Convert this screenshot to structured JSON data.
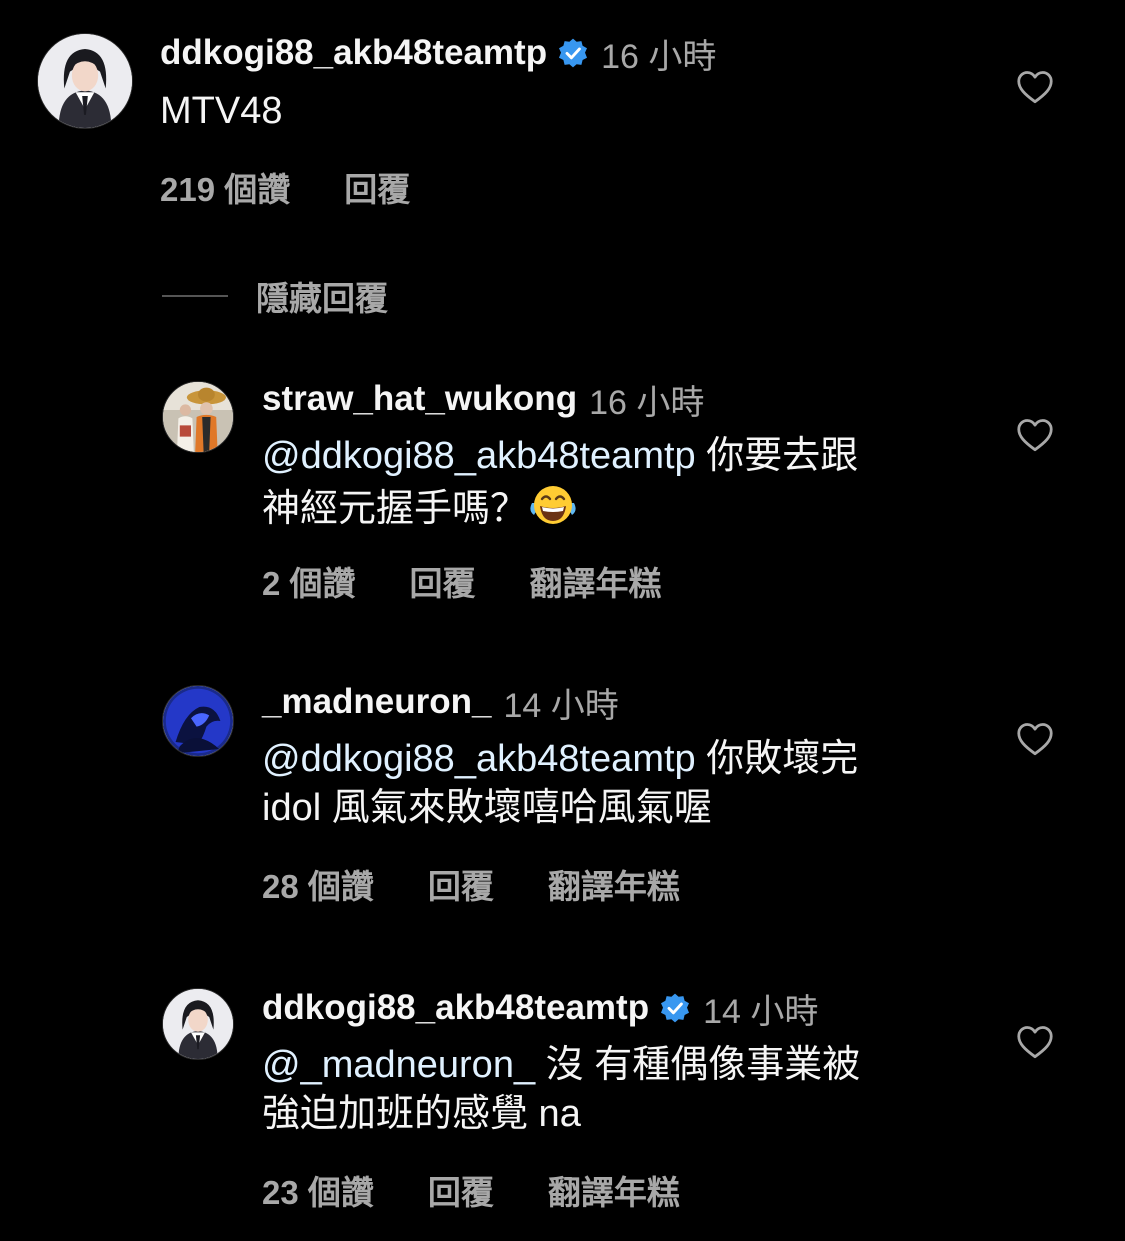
{
  "comments": [
    {
      "username": "ddkogi88_akb48teamtp",
      "verified": true,
      "time": "16 小時",
      "text": "MTV48",
      "likes": "219 個讚",
      "reply": "回覆",
      "translate": ""
    },
    {
      "username": "straw_hat_wukong",
      "verified": false,
      "time": "16 小時",
      "mention": "@ddkogi88_akb48teamtp",
      "line1_rest": " 你要去跟",
      "line2": "神經元握手嗎？",
      "likes": "2 個讚",
      "reply": "回覆",
      "translate": "翻譯年糕"
    },
    {
      "username": "_madneuron_",
      "verified": false,
      "time": "14 小時",
      "mention": "@ddkogi88_akb48teamtp",
      "line1_rest": " 你敗壞完",
      "line2": "idol 風氣來敗壞嘻哈風氣喔",
      "likes": "28 個讚",
      "reply": "回覆",
      "translate": "翻譯年糕"
    },
    {
      "username": "ddkogi88_akb48teamtp",
      "verified": true,
      "time": "14 小時",
      "mention": "@_madneuron_",
      "line1_rest": " 沒 有種偶像事業被",
      "line2": "強迫加班的感覺 na",
      "likes": "23 個讚",
      "reply": "回覆",
      "translate": "翻譯年糕"
    }
  ],
  "hide_replies": "隱藏回覆",
  "colors": {
    "background": "#000000",
    "text_primary": "#f5f5f5",
    "text_secondary": "#a8a8a8",
    "verified_badge": "#3897f0"
  },
  "icons": {
    "like": "heart-outline-icon",
    "verified": "verified-badge-icon",
    "emoji": "face-with-tears-of-joy"
  }
}
